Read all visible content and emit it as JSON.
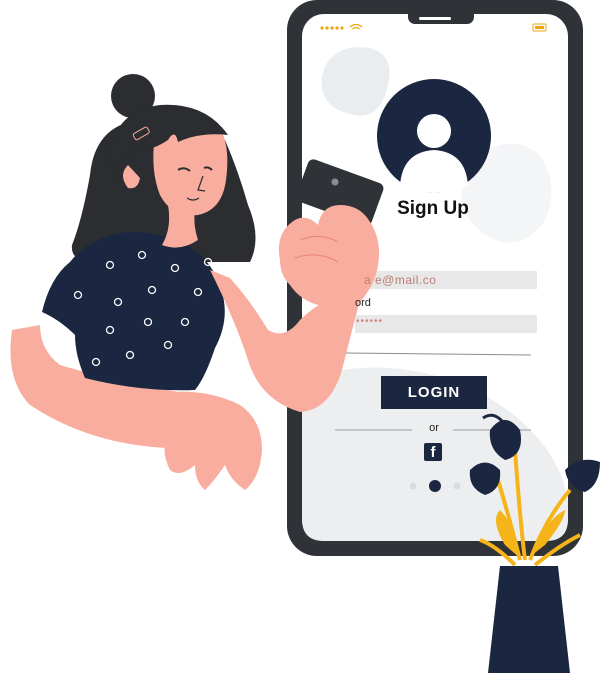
{
  "signup": {
    "title": "Sign Up",
    "email_value": "a    e@mail.co",
    "password_label": "ord",
    "password_dots": "••••••",
    "login_label": "LOGIN",
    "or_label": "or",
    "facebook_glyph": "f"
  },
  "colors": {
    "navy": "#1b2640",
    "skin": "#f9ad9f",
    "hair": "#2b2d30",
    "phone_frame": "#2f3236",
    "accent_yellow": "#f4b41a",
    "status_orange": "#f0a40a"
  },
  "icons": [
    "wifi-icon",
    "battery-icon",
    "avatar-icon",
    "facebook-icon",
    "plant-illustration",
    "woman-illustration"
  ]
}
